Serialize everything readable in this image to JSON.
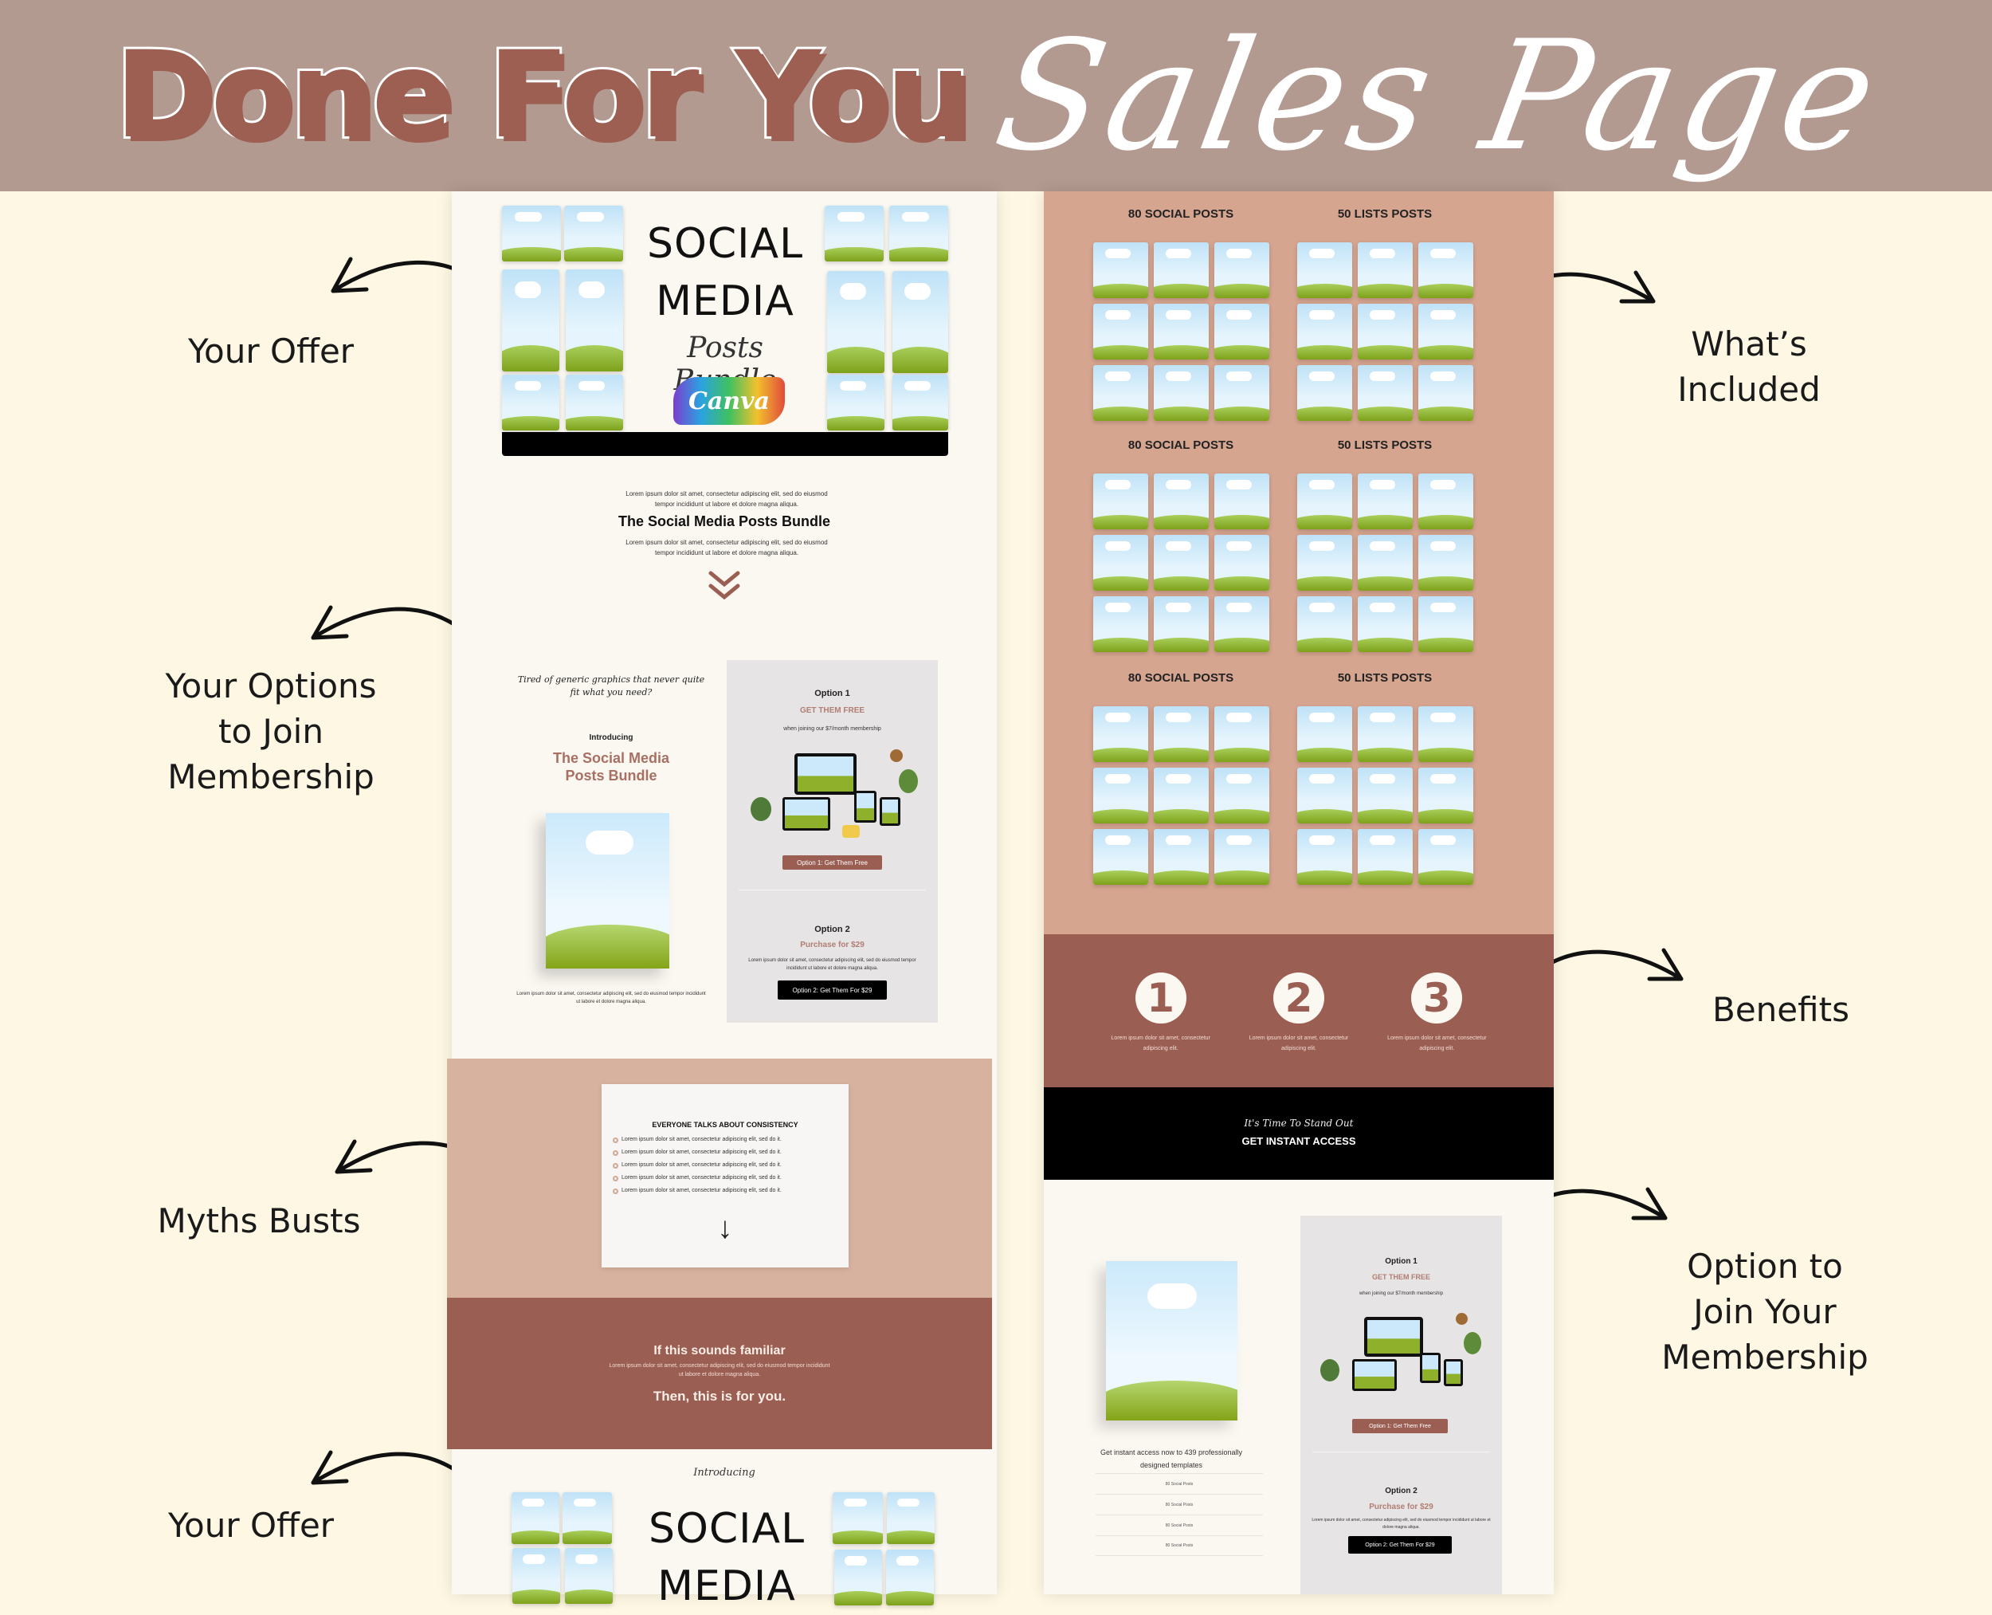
{
  "header": {
    "title_block": "Done For You",
    "title_script": "Sales Page"
  },
  "labels": {
    "your_offer_top": "Your Offer",
    "your_options": [
      "Your Options",
      "to Join",
      "Membership"
    ],
    "myths_busts": "Myths Busts",
    "your_offer_bottom": "Your Offer",
    "whats_included": [
      "What’s",
      "Included"
    ],
    "benefits": "Benefits",
    "option_to_join": [
      "Option to",
      "Join Your",
      "Membership"
    ]
  },
  "left": {
    "hero": {
      "line1": "SOCIAL",
      "line2": "MEDIA",
      "script": "Posts Bundle",
      "brand": "Canva"
    },
    "intro_lorem": "Lorem ipsum dolor sit amet, consectetur adipiscing elit, sed do eiusmod tempor incididunt ut labore et dolore magna aliqua.",
    "bundle_title": "The Social Media Posts Bundle",
    "outro_lorem": "Lorem ipsum dolor sit amet, consectetur adipiscing elit, sed do eiusmod tempor incididunt ut labore et dolore magna aliqua.",
    "options": {
      "tagline": "Tired of generic graphics that never quite fit what you need?",
      "introducing": "Introducing",
      "product_title": "The Social Media Posts Bundle",
      "product_lorem": "Lorem ipsum dolor sit amet, consectetur adipiscing elit, sed do eiusmod tempor incididunt ut labore et dolore magna aliqua.",
      "option1": {
        "title": "Option 1",
        "accent": "GET THEM FREE",
        "sub": "when joining our $7/month membership",
        "button": "Option 1: Get Them Free"
      },
      "option2": {
        "title": "Option 2",
        "accent": "Purchase for $29",
        "lorem": "Lorem ipsum dolor sit amet, consectetur adipiscing elit, sed do eiusmod tempor incididunt ut labore et dolore magna aliqua.",
        "button": "Option 2: Get Them For $29"
      }
    },
    "myths": {
      "heading": "EVERYONE TALKS ABOUT CONSISTENCY",
      "bullets": [
        "Lorem ipsum dolor sit amet, consectetur adipiscing elit, sed do it.",
        "Lorem ipsum dolor sit amet, consectetur adipiscing elit, sed do it.",
        "Lorem ipsum dolor sit amet, consectetur adipiscing elit, sed do it.",
        "Lorem ipsum dolor sit amet, consectetur adipiscing elit, sed do it.",
        "Lorem ipsum dolor sit amet, consectetur adipiscing elit, sed do it."
      ],
      "familiar": "If this sounds familiar",
      "familiar_lorem": "Lorem ipsum dolor sit amet, consectetur adipiscing elit, sed do eiusmod tempor incididunt ut labore et dolore magna aliqua.",
      "for_you": "Then, this is for you."
    },
    "offer_bottom": {
      "introducing": "Introducing",
      "line1": "SOCIAL",
      "line2": "MEDIA"
    }
  },
  "right": {
    "groups": [
      {
        "left": "80 SOCIAL POSTS",
        "right": "50 LISTS POSTS"
      },
      {
        "left": "80 SOCIAL POSTS",
        "right": "50 LISTS POSTS"
      },
      {
        "left": "80 SOCIAL POSTS",
        "right": "50 LISTS POSTS"
      }
    ],
    "benefits": [
      {
        "num": "1",
        "text": "Lorem ipsum dolor sit amet, consectetur adipiscing elit."
      },
      {
        "num": "2",
        "text": "Lorem ipsum dolor sit amet, consectetur adipiscing elit."
      },
      {
        "num": "3",
        "text": "Lorem ipsum dolor sit amet, consectetur adipiscing elit."
      }
    ],
    "cta": {
      "script": "It's Time To Stand Out",
      "button": "GET INSTANT ACCESS"
    },
    "join": {
      "access_text": "Get instant access now to 439 professionally designed templates",
      "list": [
        "80 Social Posts",
        "80 Social Posts",
        "80 Social Posts",
        "80 Social Posts"
      ],
      "option1": {
        "title": "Option 1",
        "accent": "GET THEM FREE",
        "sub": "when joining our $7/month membership",
        "button": "Option 1: Get Them Free"
      },
      "option2": {
        "title": "Option 2",
        "accent": "Purchase for $29",
        "lorem": "Lorem ipsum dolor sit amet, consectetur adipiscing elit, sed do eiusmod tempor incididunt ut labore et dolore magna aliqua.",
        "button": "Option 2: Get Them For $29"
      }
    }
  },
  "colors": {
    "header_bg": "#b39a90",
    "brand": "#9b5e53",
    "accent": "#b07e72",
    "tan": "#d6a590",
    "cream": "#fdf7e3"
  }
}
